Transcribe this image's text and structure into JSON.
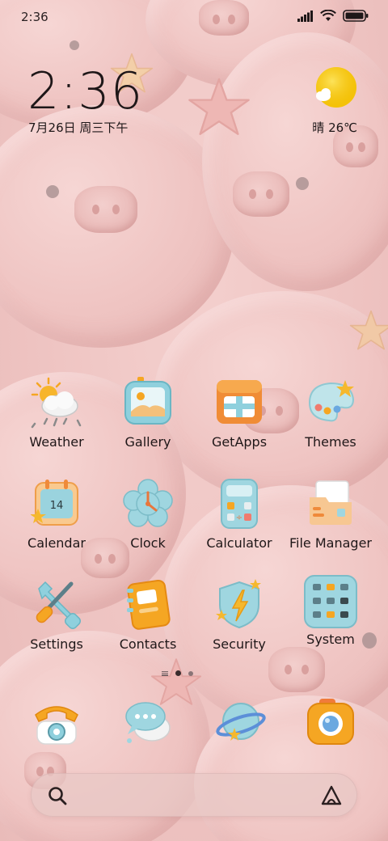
{
  "status_bar": {
    "time": "2:36"
  },
  "clock_widget": {
    "time": "2:36",
    "date": "7月26日 周三下午"
  },
  "weather_widget": {
    "condition_temp": "晴 26℃"
  },
  "apps": [
    {
      "label": "Weather",
      "icon": "weather-icon"
    },
    {
      "label": "Gallery",
      "icon": "gallery-icon"
    },
    {
      "label": "GetApps",
      "icon": "getapps-icon"
    },
    {
      "label": "Themes",
      "icon": "themes-icon"
    },
    {
      "label": "Calendar",
      "icon": "calendar-icon",
      "badge": "14"
    },
    {
      "label": "Clock",
      "icon": "clock-icon"
    },
    {
      "label": "Calculator",
      "icon": "calculator-icon"
    },
    {
      "label": "File Manager",
      "icon": "file-manager-icon"
    },
    {
      "label": "Settings",
      "icon": "settings-icon"
    },
    {
      "label": "Contacts",
      "icon": "contacts-icon"
    },
    {
      "label": "Security",
      "icon": "security-icon"
    },
    {
      "label": "System",
      "icon": "system-folder-icon"
    }
  ],
  "dock": [
    "phone-icon",
    "messages-icon",
    "browser-icon",
    "camera-icon"
  ],
  "page_indicator": {
    "pages": 2,
    "current": 1
  },
  "colors": {
    "accent_orange": "#f5a623",
    "accent_blue": "#8fd3e0",
    "wallpaper_pink": "#f0c8c6"
  }
}
